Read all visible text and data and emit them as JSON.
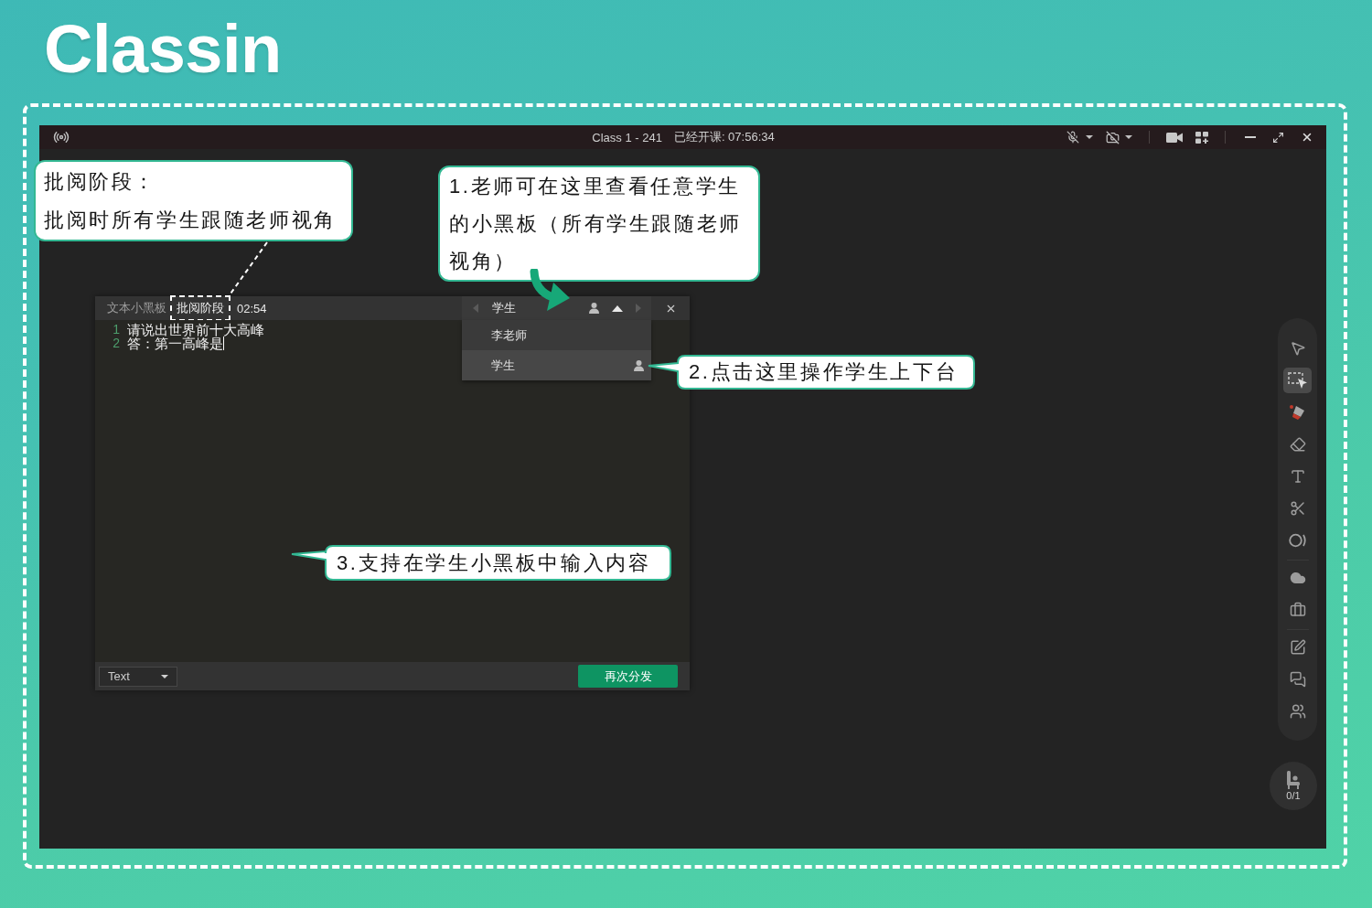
{
  "logo": {
    "text": "Classin"
  },
  "window": {
    "title": "Class 1 - 241",
    "elapsed": "已经开课: 07:56:34",
    "microphone_on": false,
    "camera_on": false
  },
  "blackboard": {
    "title": "文本小黑板",
    "stage": "批阅阶段",
    "timer": "02:54",
    "picker": {
      "current": "学生",
      "on_stage": true,
      "expanded": true
    },
    "students": [
      {
        "name": "李老师",
        "selected": false,
        "on_stage": false
      },
      {
        "name": "学生",
        "selected": true,
        "on_stage": true
      }
    ],
    "lines": [
      {
        "number": "1",
        "text": "请说出世界前十大高峰",
        "cursor": false
      },
      {
        "number": "2",
        "text": "答：第一高峰是",
        "cursor": true
      }
    ],
    "format": "Text",
    "redistribute_button": "再次分发"
  },
  "toolbar": {
    "groups": [
      {
        "tools": [
          {
            "kind": "pointer",
            "selected": false
          },
          {
            "kind": "selection",
            "selected": true
          },
          {
            "kind": "marker",
            "selected": false
          },
          {
            "kind": "eraser",
            "selected": false
          },
          {
            "kind": "text",
            "selected": false
          },
          {
            "kind": "scissors",
            "selected": false
          },
          {
            "kind": "ring",
            "selected": false
          }
        ]
      },
      {
        "tools": [
          {
            "kind": "cloud",
            "selected": false
          },
          {
            "kind": "toolbox",
            "selected": false
          }
        ]
      },
      {
        "tools": [
          {
            "kind": "edit",
            "selected": false
          },
          {
            "kind": "chat",
            "selected": false
          },
          {
            "kind": "users",
            "selected": false
          }
        ]
      }
    ]
  },
  "seat_counter": {
    "count": "0/1"
  },
  "callouts": [
    {
      "kind": "leader",
      "lines": [
        "批阅阶段：",
        "批阅时所有学生跟随老师视角"
      ]
    },
    {
      "kind": "arrow",
      "lines": [
        "1.老师可在这里查看任意学生",
        "的小黑板（所有学生跟随老师",
        "视角）"
      ]
    },
    {
      "kind": "tail",
      "lines": [
        "2.点击这里操作学生上下台"
      ]
    },
    {
      "kind": "tail",
      "lines": [
        "3.支持在学生小黑板中输入内容"
      ]
    }
  ]
}
